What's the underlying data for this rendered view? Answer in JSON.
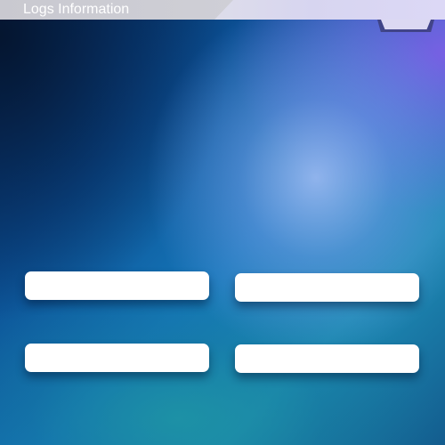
{
  "header": {
    "title": "Logs Information"
  },
  "fields": [
    {
      "value": ""
    },
    {
      "value": ""
    },
    {
      "value": ""
    },
    {
      "value": ""
    }
  ],
  "colors": {
    "header_bg": "#dedee9",
    "header_tab": "#cfcfd6",
    "field_bg": "#ffffff",
    "bg_dark": "#032a5a",
    "bg_accent_purple": "#7d5fe6",
    "bg_accent_teal": "#1d8bb5"
  }
}
